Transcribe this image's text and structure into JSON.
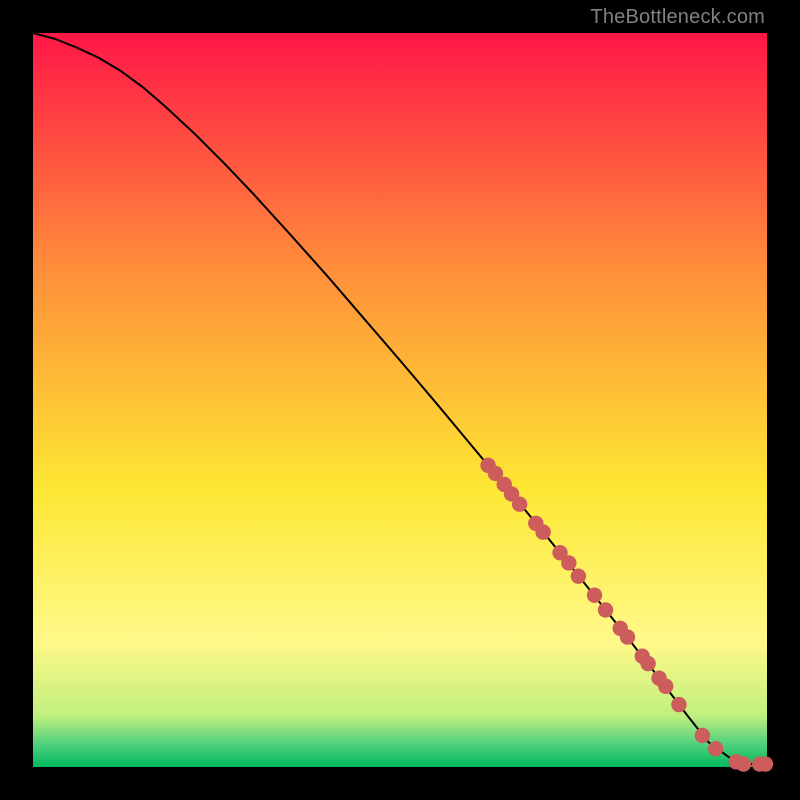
{
  "watermark": "TheBottleneck.com",
  "colors": {
    "marker_fill": "#cd5c5c",
    "marker_stroke": "#cd5c5c",
    "curve": "#000000",
    "bg_top": "#ff1647",
    "bg_mid1": "#ff8d3a",
    "bg_mid2": "#fde733",
    "bg_mid3": "#fff98a",
    "bg_low1": "#c0ef7e",
    "bg_low2": "#5bd37e",
    "bg_bottom": "#00b85e"
  },
  "chart_data": {
    "type": "line",
    "title": "",
    "xlabel": "",
    "ylabel": "",
    "xlim": [
      0,
      100
    ],
    "ylim": [
      0,
      100
    ],
    "grid": false,
    "legend": false,
    "series": [
      {
        "name": "curve",
        "kind": "line",
        "x": [
          0,
          3,
          6,
          9,
          12,
          15,
          18,
          22,
          26,
          30,
          35,
          40,
          45,
          50,
          55,
          60,
          65,
          70,
          75,
          80,
          85,
          89,
          92,
          95,
          97.5,
          100
        ],
        "y": [
          100,
          99.2,
          98.0,
          96.6,
          94.8,
          92.6,
          90.0,
          86.3,
          82.3,
          78.1,
          72.6,
          67.0,
          61.2,
          55.4,
          49.5,
          43.5,
          37.5,
          31.4,
          25.2,
          18.9,
          12.5,
          7.2,
          3.4,
          1.2,
          0.4,
          0.4
        ]
      },
      {
        "name": "markers",
        "kind": "scatter",
        "x": [
          62.0,
          63.0,
          64.2,
          65.2,
          66.3,
          68.5,
          69.5,
          71.8,
          73.0,
          74.3,
          76.5,
          78.0,
          80.0,
          81.0,
          83.0,
          83.8,
          85.3,
          86.2,
          88.0,
          91.2,
          93.0,
          95.8,
          96.8,
          99.0,
          99.8
        ],
        "y": [
          41.1,
          40.0,
          38.5,
          37.2,
          35.8,
          33.2,
          32.0,
          29.2,
          27.8,
          26.0,
          23.4,
          21.4,
          18.9,
          17.7,
          15.1,
          14.1,
          12.1,
          11.0,
          8.5,
          4.3,
          2.5,
          0.7,
          0.4,
          0.4,
          0.4
        ]
      }
    ]
  }
}
